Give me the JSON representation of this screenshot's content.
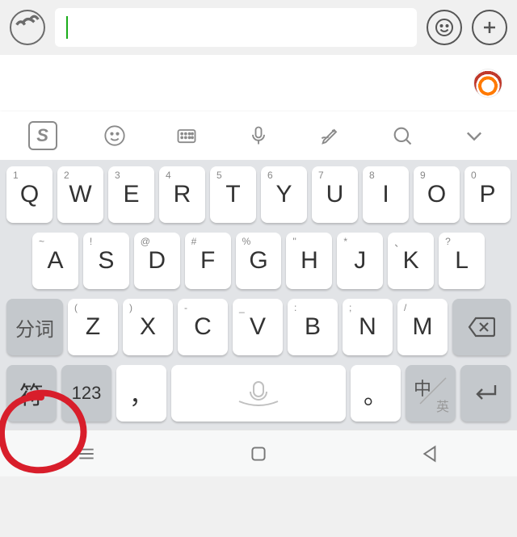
{
  "topbar": {
    "input_value": "",
    "input_placeholder": ""
  },
  "kb_toolbar": {
    "logo": "S"
  },
  "keyboard": {
    "row1": [
      {
        "main": "Q",
        "sub": "1"
      },
      {
        "main": "W",
        "sub": "2"
      },
      {
        "main": "E",
        "sub": "3"
      },
      {
        "main": "R",
        "sub": "4"
      },
      {
        "main": "T",
        "sub": "5"
      },
      {
        "main": "Y",
        "sub": "6"
      },
      {
        "main": "U",
        "sub": "7"
      },
      {
        "main": "I",
        "sub": "8"
      },
      {
        "main": "O",
        "sub": "9"
      },
      {
        "main": "P",
        "sub": "0"
      }
    ],
    "row2": [
      {
        "main": "A",
        "sub": "~"
      },
      {
        "main": "S",
        "sub": "!"
      },
      {
        "main": "D",
        "sub": "@"
      },
      {
        "main": "F",
        "sub": "#"
      },
      {
        "main": "G",
        "sub": "%"
      },
      {
        "main": "H",
        "sub": "\""
      },
      {
        "main": "J",
        "sub": "*"
      },
      {
        "main": "K",
        "sub": "、"
      },
      {
        "main": "L",
        "sub": "?"
      }
    ],
    "row3": {
      "fenci": "分词",
      "keys": [
        {
          "main": "Z",
          "sub": "("
        },
        {
          "main": "X",
          "sub": ")"
        },
        {
          "main": "C",
          "sub": "-"
        },
        {
          "main": "V",
          "sub": "_"
        },
        {
          "main": "B",
          "sub": ":"
        },
        {
          "main": "N",
          "sub": ";"
        },
        {
          "main": "M",
          "sub": "/"
        }
      ]
    },
    "row4": {
      "symbol": "符",
      "numeric": "123",
      "comma": "，",
      "period": "。",
      "lang_main": "中",
      "lang_sub": "英"
    }
  }
}
